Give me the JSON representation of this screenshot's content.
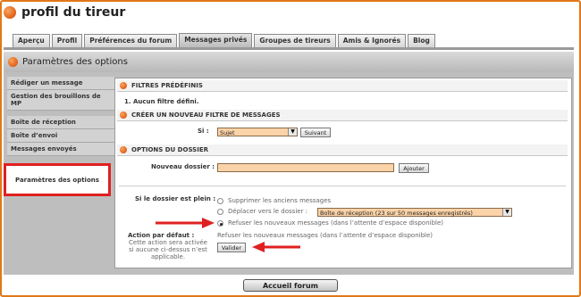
{
  "header": {
    "title": "profil du tireur"
  },
  "tabs": [
    "Aperçu",
    "Profil",
    "Préférences du forum",
    "Messages privés",
    "Groupes de tireurs",
    "Amis & Ignorés",
    "Blog"
  ],
  "active_tab": "Messages privés",
  "panel": {
    "title": "Paramètres des options"
  },
  "sidebar": {
    "items": [
      "Rédiger un message",
      "Gestion des brouillons de MP",
      "Boîte de réception",
      "Boîte d’envoi",
      "Messages envoyés",
      "Paramètres des options"
    ]
  },
  "sections": {
    "filtres_predefinis": {
      "title": "FILTRES PRÉDÉFINIS",
      "item": "1.  Aucun filtre défini."
    },
    "nouveau_filtre": {
      "title": "CRÉER UN NOUVEAU FILTRE DE MESSAGES",
      "si_label": "Si :",
      "si_value": "Sujet",
      "next_button": "Suivant"
    },
    "options_dossier": {
      "title": "OPTIONS DU DOSSIER",
      "nouveau_label": "Nouveau dossier :",
      "add_button": "Ajouter"
    }
  },
  "dossier_plein": {
    "label": "Si le dossier est plein :",
    "options": [
      "Supprimer les anciens messages",
      "Déplacer vers le dossier :",
      "Refuser les nouveaux messages (dans l’attente d’espace disponible)"
    ],
    "folder_select": "Boîte de réception (23 sur 50 messages enregistrés)",
    "selected_index": 2
  },
  "action_defaut": {
    "label": "Action par défaut :",
    "note": [
      "Cette action sera activée",
      "si aucune ci-dessus n’est",
      "applicable."
    ],
    "value": "Refuser les nouveaux messages (dans l’attente d’espace disponible)",
    "submit_button": "Valider"
  },
  "footer": {
    "button": "Accueil forum"
  },
  "colors": {
    "accent": "#e07818",
    "highlight_red": "#e02020",
    "field_bg": "#fbd3a8"
  }
}
